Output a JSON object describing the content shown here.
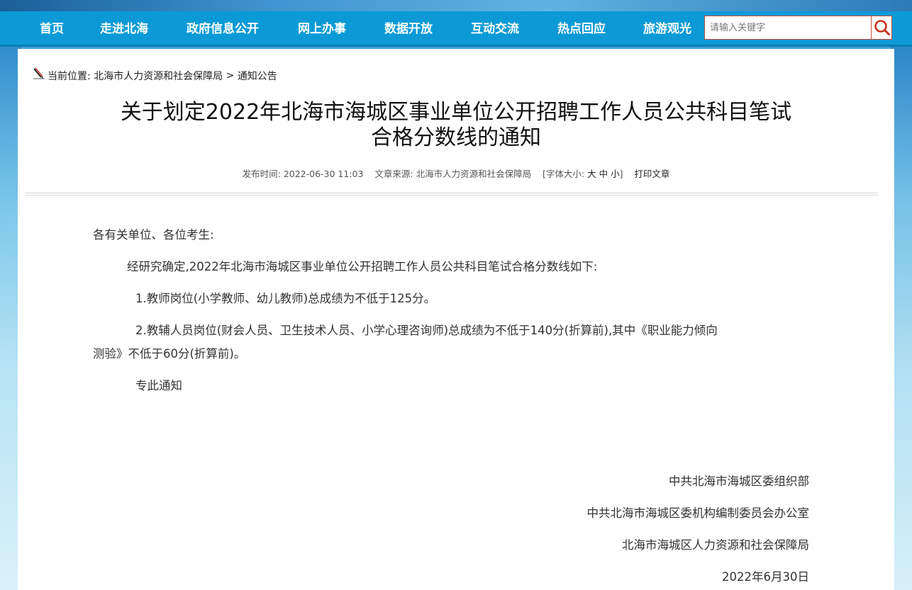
{
  "nav": {
    "items": [
      "首页",
      "走进北海",
      "政府信息公开",
      "网上办事",
      "数据开放",
      "互动交流",
      "热点回应",
      "旅游观光"
    ]
  },
  "search": {
    "placeholder": "请输入关键字"
  },
  "breadcrumb": {
    "prefix": "当前位置:",
    "items": [
      "北海市人力资源和社会保障局",
      "通知公告"
    ],
    "separator": ">"
  },
  "article": {
    "title_line1": "关于划定2022年北海市海城区事业单位公开招聘工作人员公共科目笔试",
    "title_line2": "合格分数线的通知",
    "meta": {
      "publish_label": "发布时间:",
      "publish_time": "2022-06-30 11:03",
      "source_label": "文章来源:",
      "source": "北海市人力资源和社会保障局",
      "fontsize_label": "[字体大小:",
      "fontsize_options": [
        "大",
        "中",
        "小"
      ],
      "fontsize_close": "]",
      "print": "打印文章"
    },
    "salutation": "各有关单位、各位考生:",
    "intro": "经研究确定,2022年北海市海城区事业单位公开招聘工作人员公共科目笔试合格分数线如下:",
    "item1": "1.教师岗位(小学教师、幼儿教师)总成绩为不低于125分。",
    "item2_line1": "2.教辅人员岗位(财会人员、卫生技术人员、小学心理咨询师)总成绩为不低于140分(折算前),其中《职业能力倾向",
    "item2_line2": "测验》不低于60分(折算前)。",
    "closing": "专此通知",
    "signatures": [
      "中共北海市海城区委组织部",
      "中共北海市海城区委机构编制委员会办公室",
      "北海市海城区人力资源和社会保障局"
    ],
    "date": "2022年6月30日"
  },
  "colors": {
    "nav_bg": "#0b9ad6",
    "search_border": "#c94a3a"
  }
}
